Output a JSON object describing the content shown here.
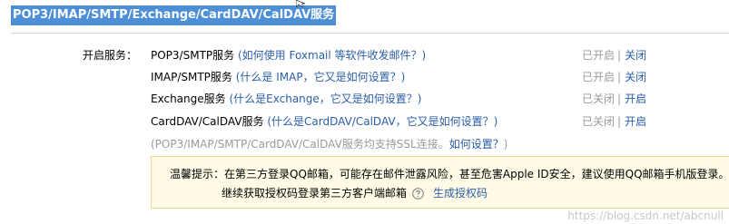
{
  "section": {
    "title": "POP3/IMAP/SMTP/Exchange/CardDAV/CalDAV服务"
  },
  "services": {
    "label": "开启服务：",
    "rows": [
      {
        "name": "POP3/SMTP服务",
        "help": "(如何使用 Foxmail 等软件收发邮件？)",
        "status": "已开启",
        "action": "关闭"
      },
      {
        "name": "IMAP/SMTP服务",
        "help": "(什么是 IMAP，它又是如何设置？)",
        "status": "已开启",
        "action": "关闭"
      },
      {
        "name": "Exchange服务",
        "help": "(什么是Exchange，它又是如何设置？)",
        "status": "已关闭",
        "action": "开启"
      },
      {
        "name": "CardDAV/CalDAV服务",
        "help": "(什么是CardDAV/CalDAV，它又是如何设置？)",
        "status": "已关闭",
        "action": "开启"
      }
    ],
    "separator": "|"
  },
  "ssl_note": {
    "text_before": "(POP3/IMAP/SMTP/CardDAV/CalDAV服务均支持SSL连接。",
    "link": "如何设置？",
    "text_after": ")"
  },
  "warning": {
    "line1": "温馨提示：在第三方登录QQ邮箱，可能存在邮件泄露风险，甚至危害Apple ID安全，建议使用QQ邮箱手机版登录。",
    "line2": "继续获取授权码登录第三方客户端邮箱",
    "generate_link": "生成授权码"
  },
  "watermark": "https://blog.csdn.net/abcnull",
  "icons": {
    "cursor": "cursor-icon",
    "help": "question-circle-icon"
  },
  "colors": {
    "title_bg": "#4d8fd6",
    "link": "#2a5ea9",
    "muted": "#9a9a9a",
    "warn_bg": "#fffbe6",
    "warn_border": "#f0d98a"
  }
}
